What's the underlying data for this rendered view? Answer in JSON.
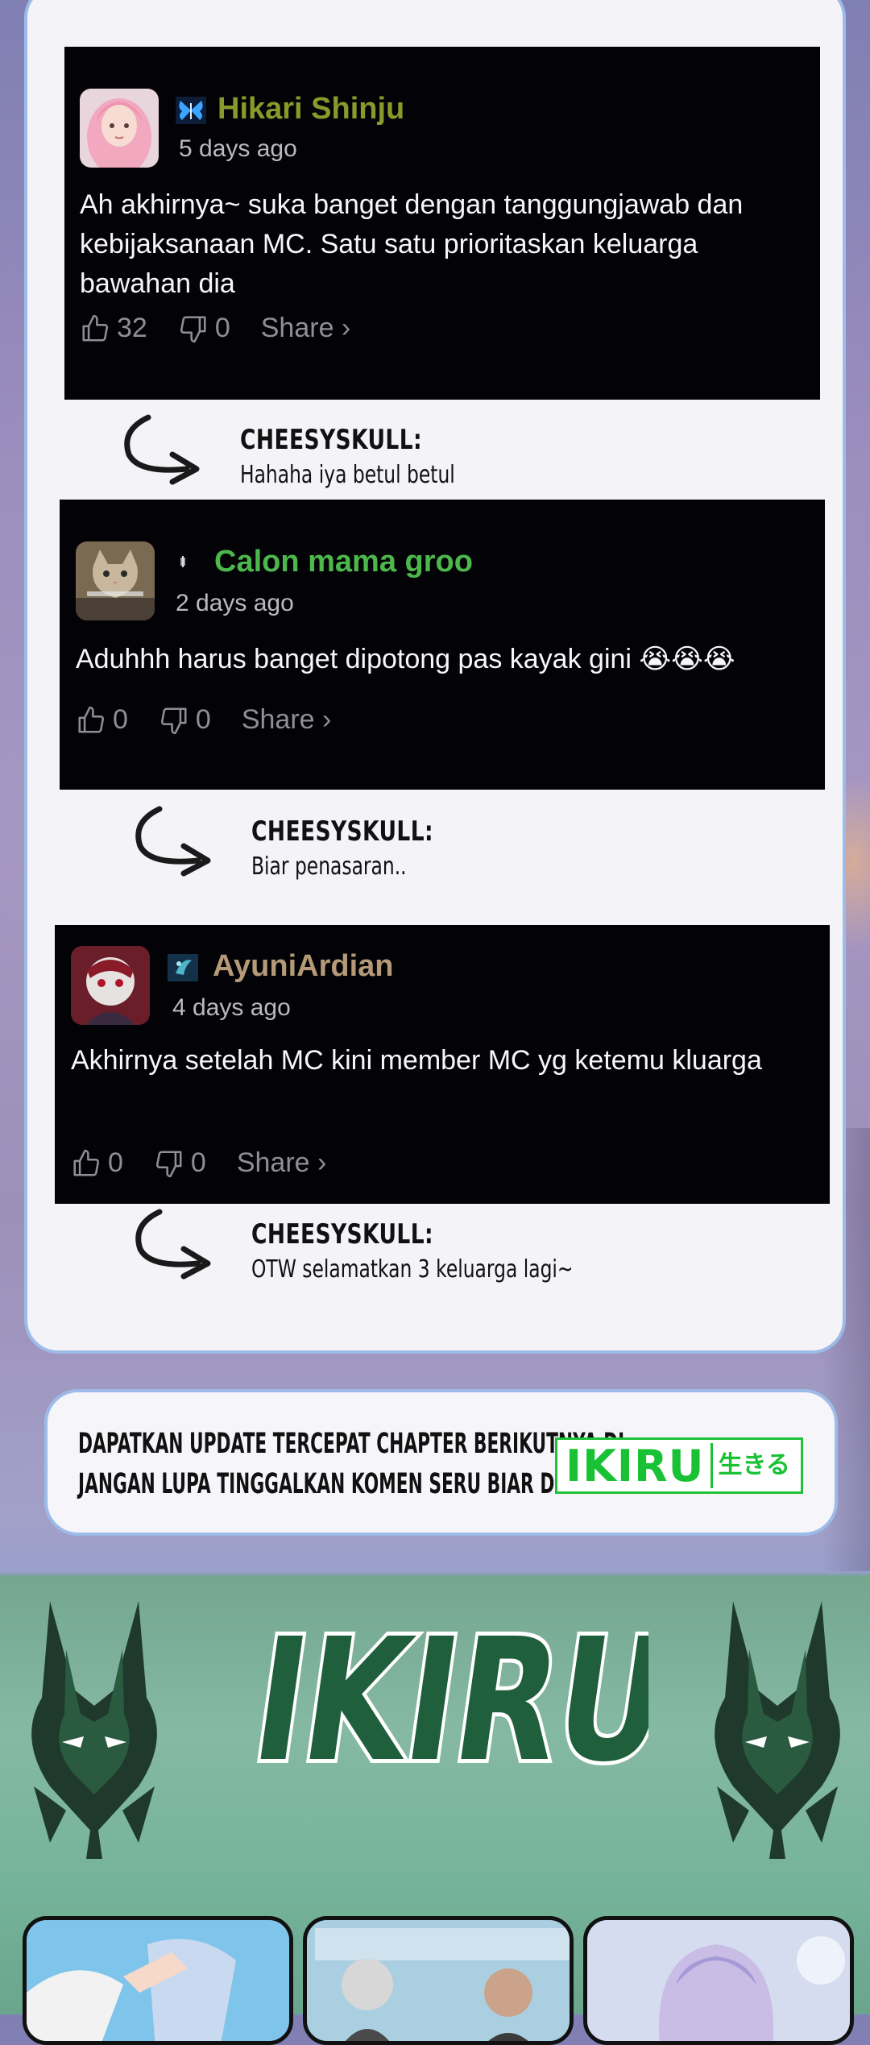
{
  "comments": [
    {
      "username": "Hikari Shinju",
      "username_color": "#8a9a2a",
      "time": "5 days ago",
      "text": "Ah akhirnya~ suka banget dengan tanggungjawab dan kebijaksanaan MC. Satu satu prioritaskan keluarga bawahan dia",
      "likes": "32",
      "dislikes": "0",
      "share": "Share ›",
      "avatar_icon": "pink-hair-avatar",
      "flair_icon": "butterfly-icon",
      "reply_author": "CHEESYSKULL:",
      "reply_text": "Hahaha iya betul betul"
    },
    {
      "username": "Calon mama groo",
      "username_color": "#4cb84c",
      "time": "2 days ago",
      "text": "Aduhhh harus banget dipotong pas kayak gini 😭😭😭",
      "likes": "0",
      "dislikes": "0",
      "share": "Share ›",
      "avatar_icon": "cat-avatar",
      "flair_icon": "small-flair-icon",
      "reply_author": "CHEESYSKULL:",
      "reply_text": "Biar penasaran.."
    },
    {
      "username": "AyuniArdian",
      "username_color": "#b59a78",
      "time": "4 days ago",
      "text": "Akhirnya setelah MC kini member MC yg ketemu kluarga",
      "likes": "0",
      "dislikes": "0",
      "share": "Share ›",
      "avatar_icon": "character-avatar",
      "flair_icon": "teal-flair-icon",
      "reply_author": "CHEESYSKULL:",
      "reply_text": "OTW selamatkan 3 keluarga lagi~"
    }
  ],
  "notify": {
    "line1": "DAPATKAN UPDATE TERCEPAT CHAPTER BERIKUTNYA DI",
    "line2": "JANGAN LUPA TINGGALKAN KOMEN SERU BIAR DI NOTIS",
    "logo_main": "IKIRU",
    "logo_sub": "生きる",
    "logo_color": "#19c135"
  },
  "brand": {
    "title": "IKIRU",
    "title_color": "#1f5f3c",
    "mascot_icon": "wolf-head-icon"
  }
}
